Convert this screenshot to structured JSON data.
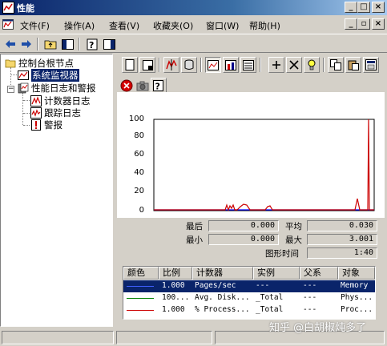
{
  "window": {
    "title": "性能"
  },
  "menu": {
    "items": [
      "文件(F)",
      "操作(A)",
      "查看(V)",
      "收藏夹(O)",
      "窗口(W)",
      "帮助(H)"
    ]
  },
  "tree": {
    "root": "控制台根节点",
    "system_monitor": "系统监视器",
    "perf_logs": "性能日志和警报",
    "counter_logs": "计数器日志",
    "trace_logs": "跟踪日志",
    "alerts": "警报"
  },
  "graph": {
    "y_ticks": [
      "100",
      "80",
      "60",
      "40",
      "20",
      "0"
    ]
  },
  "stats": {
    "last_label": "最后",
    "last_value": "0.000",
    "avg_label": "平均",
    "avg_value": "0.030",
    "min_label": "最小",
    "min_value": "0.000",
    "max_label": "最大",
    "max_value": "3.001",
    "duration_label": "图形时间",
    "duration_value": "1:40"
  },
  "legend": {
    "headers": [
      "颜色",
      "比例",
      "计数器",
      "实例",
      "父系",
      "对象"
    ],
    "rows": [
      {
        "color": "#0000ff",
        "scale": "1.000",
        "counter": "Pages/sec",
        "instance": "---",
        "parent": "---",
        "object": "Memory"
      },
      {
        "color": "#008000",
        "scale": "100...",
        "counter": "Avg. Disk...",
        "instance": "_Total",
        "parent": "---",
        "object": "Phys..."
      },
      {
        "color": "#cc0000",
        "scale": "1.000",
        "counter": "% Process...",
        "instance": "_Total",
        "parent": "---",
        "object": "Proc..."
      }
    ]
  },
  "watermark": "知乎 @白胡椒炖多了"
}
